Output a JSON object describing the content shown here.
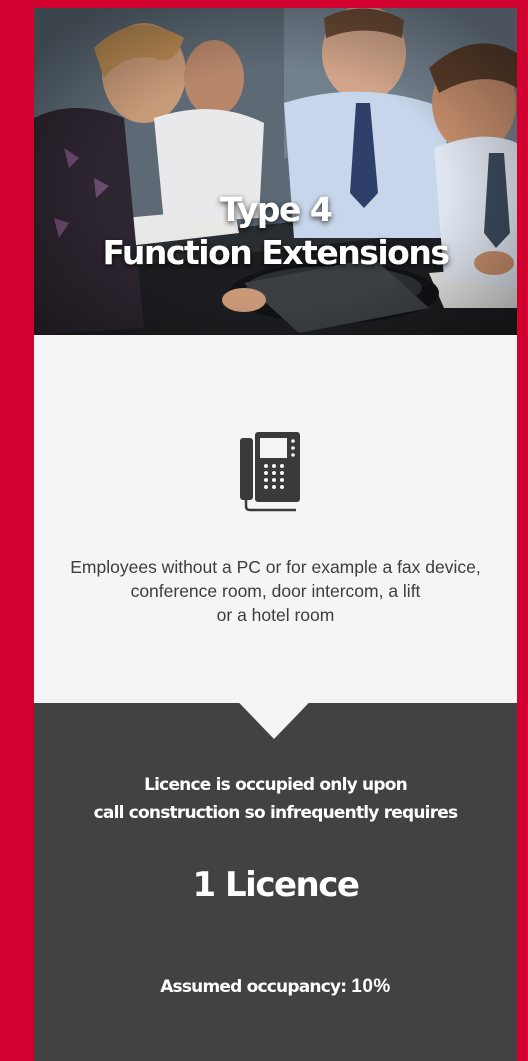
{
  "hero": {
    "title_line1": "Type 4",
    "title_line2": "Function Extensions"
  },
  "info": {
    "icon": "desk-phone-icon",
    "description_line1": "Employees without a PC or for example a fax device,",
    "description_line2": "conference room, door intercom, a lift",
    "description_line3": "or a hotel room"
  },
  "licence": {
    "lead_line1": "Licence is occupied only upon",
    "lead_line2": "call construction so infrequently requires",
    "count": "1 Licence",
    "occupancy_label": "Assumed occupancy:",
    "occupancy_value": "10%"
  },
  "colors": {
    "page_background": "#d2002f",
    "light_panel": "#f5f5f5",
    "dark_panel": "#424242",
    "icon": "#3a3a3a"
  }
}
